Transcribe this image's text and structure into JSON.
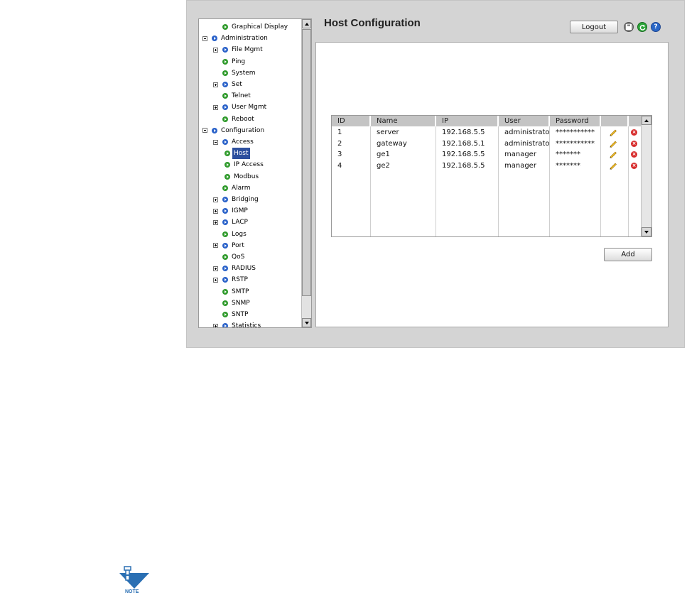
{
  "header": {
    "title": "Host Configuration",
    "logout_label": "Logout",
    "icons": [
      "save-icon",
      "refresh-icon",
      "help-icon"
    ]
  },
  "tree": {
    "items": [
      {
        "label": "Graphical Display",
        "level": 1,
        "expander": "",
        "icon": "green"
      },
      {
        "label": "Administration",
        "level": 0,
        "expander": "minus",
        "icon": "blue"
      },
      {
        "label": "File Mgmt",
        "level": 1,
        "expander": "plus",
        "icon": "blue"
      },
      {
        "label": "Ping",
        "level": 1,
        "expander": "",
        "icon": "green"
      },
      {
        "label": "System",
        "level": 1,
        "expander": "",
        "icon": "green"
      },
      {
        "label": "Set",
        "level": 1,
        "expander": "plus",
        "icon": "blue"
      },
      {
        "label": "Telnet",
        "level": 1,
        "expander": "",
        "icon": "green"
      },
      {
        "label": "User Mgmt",
        "level": 1,
        "expander": "plus",
        "icon": "blue"
      },
      {
        "label": "Reboot",
        "level": 1,
        "expander": "",
        "icon": "green"
      },
      {
        "label": "Configuration",
        "level": 0,
        "expander": "minus",
        "icon": "blue"
      },
      {
        "label": "Access",
        "level": 1,
        "expander": "minus",
        "icon": "blue"
      },
      {
        "label": "Host",
        "level": 2,
        "expander": "",
        "icon": "green",
        "selected": true
      },
      {
        "label": "IP Access",
        "level": 2,
        "expander": "",
        "icon": "green"
      },
      {
        "label": "Modbus",
        "level": 2,
        "expander": "",
        "icon": "green"
      },
      {
        "label": "Alarm",
        "level": 1,
        "expander": "",
        "icon": "green"
      },
      {
        "label": "Bridging",
        "level": 1,
        "expander": "plus",
        "icon": "blue"
      },
      {
        "label": "IGMP",
        "level": 1,
        "expander": "plus",
        "icon": "blue"
      },
      {
        "label": "LACP",
        "level": 1,
        "expander": "plus",
        "icon": "blue"
      },
      {
        "label": "Logs",
        "level": 1,
        "expander": "",
        "icon": "green"
      },
      {
        "label": "Port",
        "level": 1,
        "expander": "plus",
        "icon": "blue"
      },
      {
        "label": "QoS",
        "level": 1,
        "expander": "",
        "icon": "green"
      },
      {
        "label": "RADIUS",
        "level": 1,
        "expander": "plus",
        "icon": "blue"
      },
      {
        "label": "RSTP",
        "level": 1,
        "expander": "plus",
        "icon": "blue"
      },
      {
        "label": "SMTP",
        "level": 1,
        "expander": "",
        "icon": "green"
      },
      {
        "label": "SNMP",
        "level": 1,
        "expander": "",
        "icon": "green"
      },
      {
        "label": "SNTP",
        "level": 1,
        "expander": "",
        "icon": "green"
      },
      {
        "label": "Statistics",
        "level": 1,
        "expander": "plus",
        "icon": "blue"
      }
    ]
  },
  "host_table": {
    "columns": [
      "ID",
      "Name",
      "IP",
      "User",
      "Password",
      "",
      ""
    ],
    "rows": [
      {
        "id": "1",
        "name": "server",
        "ip": "192.168.5.5",
        "user": "administrato",
        "password": "***********"
      },
      {
        "id": "2",
        "name": "gateway",
        "ip": "192.168.5.1",
        "user": "administrato",
        "password": "***********"
      },
      {
        "id": "3",
        "name": "ge1",
        "ip": "192.168.5.5",
        "user": "manager",
        "password": "*******"
      },
      {
        "id": "4",
        "name": "ge2",
        "ip": "192.168.5.5",
        "user": "manager",
        "password": "*******"
      }
    ]
  },
  "add_label": "Add",
  "note": {
    "label": "NOTE"
  },
  "colors": {
    "frame": "#d4d4d4",
    "selected": "#2d4f9e",
    "green_icon": "#2f9a2b",
    "blue_icon": "#2a62c9",
    "table_header": "#c4c4c4",
    "note_blue": "#2a6fb3"
  }
}
